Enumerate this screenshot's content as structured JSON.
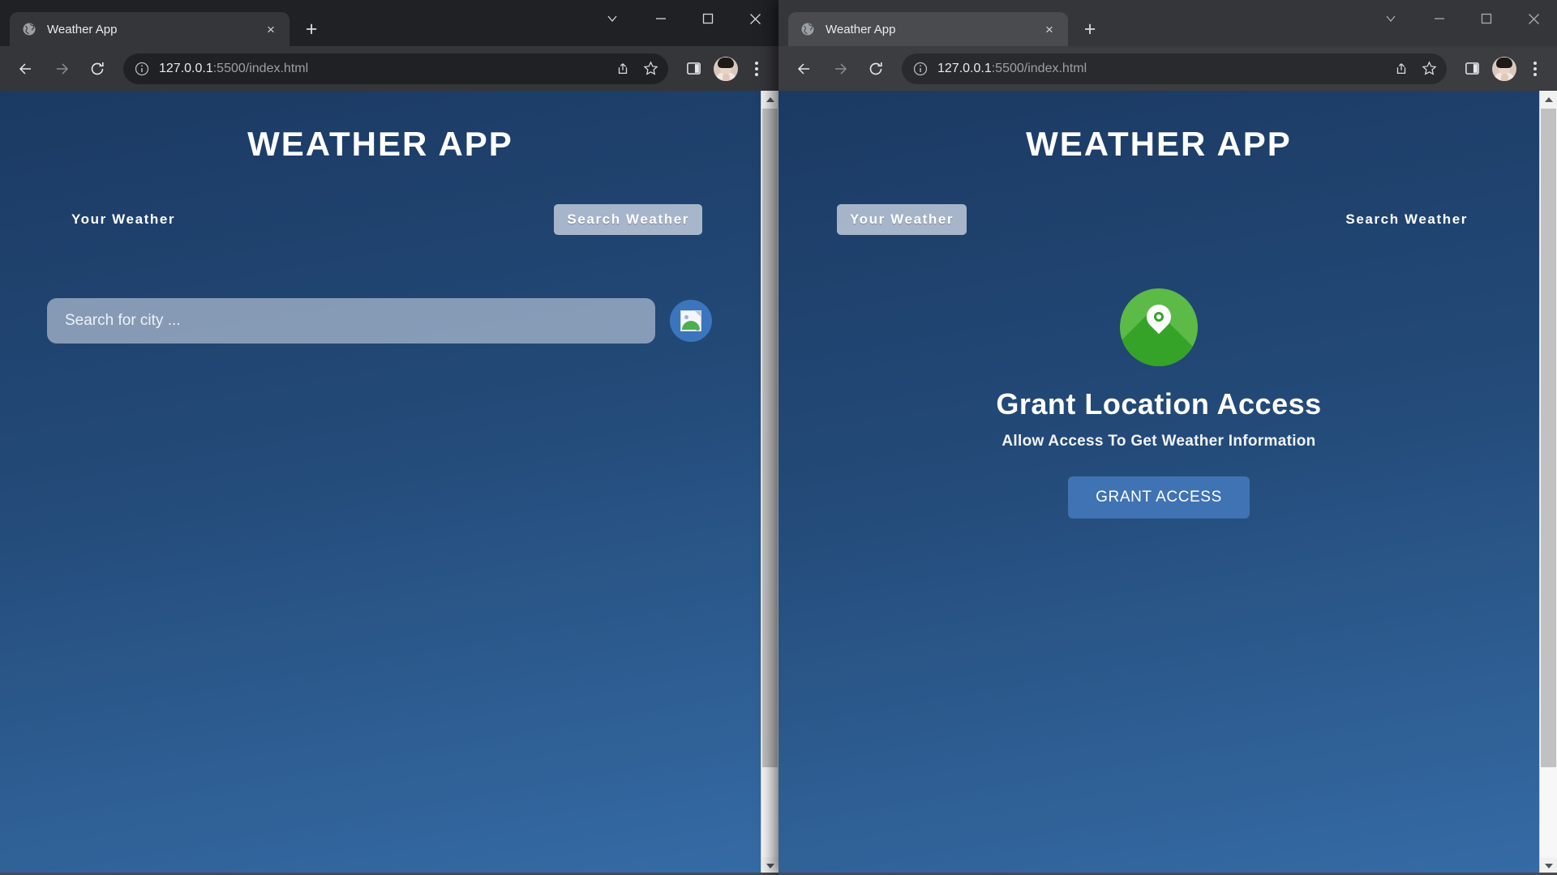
{
  "windows": [
    {
      "id": "left",
      "browser": {
        "tab": {
          "title": "Weather App",
          "favicon": "globe-icon",
          "close_label": "×"
        },
        "newtab_label": "+",
        "window_controls": {
          "chevron": "chevron-down-icon",
          "minimize": "minimize-icon",
          "maximize": "maximize-icon",
          "close": "close-icon"
        },
        "nav": {
          "back": "back-arrow-icon",
          "forward": "forward-arrow-icon",
          "reload": "reload-icon"
        },
        "omnibox": {
          "info_icon": "info-circle-icon",
          "host": "127.0.0.1",
          "path": ":5500/index.html",
          "share_icon": "share-icon",
          "bookmark_icon": "star-icon"
        },
        "toolbar": {
          "sidepanel_icon": "side-panel-icon",
          "avatar": "user-avatar",
          "menu_icon": "kebab-menu-icon"
        }
      },
      "app": {
        "title": "WEATHER APP",
        "tabs": [
          {
            "label": "Your Weather",
            "active": false
          },
          {
            "label": "Search Weather",
            "active": true
          }
        ],
        "search": {
          "placeholder": "Search for city ...",
          "value": "",
          "button_icon": "broken-image-icon"
        },
        "show_search": true,
        "show_grant": false
      },
      "scrollbar": {
        "up": "scroll-up-arrow",
        "down": "scroll-down-arrow",
        "thumb_percent": 88
      }
    },
    {
      "id": "right",
      "browser": {
        "tab": {
          "title": "Weather App",
          "favicon": "globe-icon",
          "close_label": "×"
        },
        "newtab_label": "+",
        "window_controls": {
          "chevron": "chevron-down-icon",
          "minimize": "minimize-icon",
          "maximize": "maximize-icon",
          "close": "close-icon"
        },
        "nav": {
          "back": "back-arrow-icon",
          "forward": "forward-arrow-icon",
          "reload": "reload-icon"
        },
        "omnibox": {
          "info_icon": "info-circle-icon",
          "host": "127.0.0.1",
          "path": ":5500/index.html",
          "share_icon": "share-icon",
          "bookmark_icon": "star-icon"
        },
        "toolbar": {
          "sidepanel_icon": "side-panel-icon",
          "avatar": "user-avatar",
          "menu_icon": "kebab-menu-icon"
        }
      },
      "app": {
        "title": "WEATHER APP",
        "tabs": [
          {
            "label": "Your Weather",
            "active": true
          },
          {
            "label": "Search Weather",
            "active": false
          }
        ],
        "grant": {
          "icon": "location-pin-icon",
          "title": "Grant Location Access",
          "subtitle": "Allow Access To Get Weather Information",
          "button_label": "GRANT ACCESS"
        },
        "show_search": false,
        "show_grant": true
      },
      "scrollbar": {
        "up": "scroll-up-arrow",
        "down": "scroll-down-arrow",
        "thumb_percent": 88
      }
    }
  ],
  "colors": {
    "page_gradient_top": "#1b3a63",
    "page_gradient_bottom": "#356ba5",
    "accent_button": "#3f73b4",
    "search_button": "#3b76bd",
    "location_green": "#5cba47",
    "location_green_dark": "#34a328",
    "chrome_dark": "#202124",
    "chrome_toolbar": "#35363a",
    "scrollbar_thumb": "#c1c1c1"
  }
}
